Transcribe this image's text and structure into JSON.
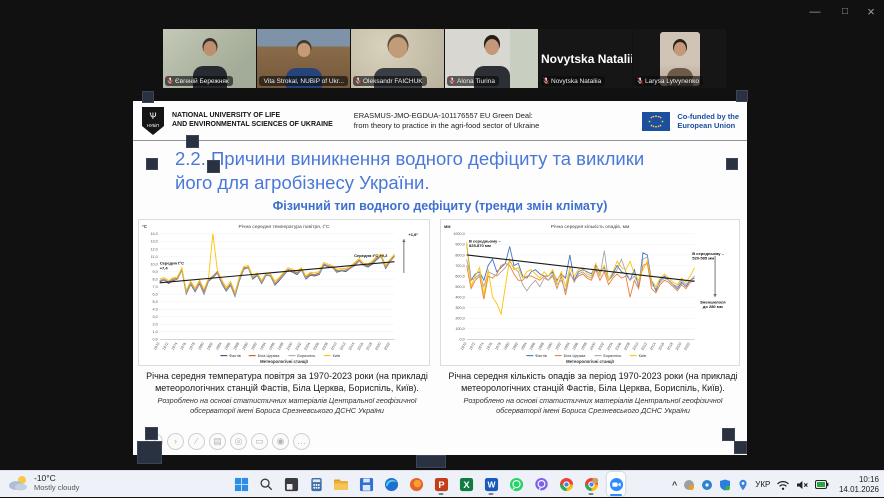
{
  "window": {
    "controls": {
      "minimize": "—",
      "maximize": "□",
      "close": "×"
    }
  },
  "participants": [
    {
      "label": "Євгеній Бережняк"
    },
    {
      "label": "Vita Strokal, NUBiP of Ukr...",
      "active_speaker": true
    },
    {
      "label": "Oleksandr FAICHUK"
    },
    {
      "label": "Alona Tiurina"
    },
    {
      "label": "Novytska Nataliia",
      "big_name": "Novytska Nataliia",
      "camera_off": true
    },
    {
      "label": "Larysa Lytvynenko"
    }
  ],
  "slide": {
    "logo_text": "НУБіП",
    "university_line1": "NATIONAL UNIVERSITY OF LIFE",
    "university_line2": "AND ENVIRONMENTAL SCIENCES OF UKRAINE",
    "erasmus_line1": "ERASMUS-JMO-EGDUA-101176557 EU Green Deal:",
    "erasmus_line2": "from theory to practice in the agri-food sector of Ukraine",
    "cofunded_line1": "Co-funded by the",
    "cofunded_line2": "European Union",
    "title_line1": "2.2. Причини виникнення водного дефіциту та виклики",
    "title_line2": "його для агробізнесу України.",
    "subtitle": "Фізичний тип водного дефіциту (тренди змін клімату)",
    "caption_left": "Річна середня температура повітря за 1970-2023 роки (на прикладі метеорологічних станцій Фастів, Біла Церква, Бориспіль, Київ).",
    "caption_right": "Річна середня кількість опадів за період 1970-2023 роки (на прикладі метеорологічних станцій Фастів, Біла Церква, Бориспіль, Київ).",
    "source_note": "Розроблено на основі статистичних матеріалів Центральної геофізичної обсерваторії імені Бориса Срезневського ДСНС України",
    "toolbar_glyphs": [
      "‹",
      "›",
      "∕",
      "▤",
      "◎",
      "▭",
      "◉",
      "…"
    ]
  },
  "chart_data": [
    {
      "type": "line",
      "title": "Річна середня температура повітря, t°C",
      "ylabel": "°C",
      "xlabel": "Метеорологічні станції",
      "ylim": [
        0,
        14
      ],
      "ystep": 1,
      "ydec": 1,
      "legend_position": "bottom",
      "x": [
        1970,
        1971,
        1972,
        1973,
        1974,
        1975,
        1976,
        1977,
        1978,
        1979,
        1980,
        1981,
        1982,
        1983,
        1984,
        1985,
        1986,
        1987,
        1988,
        1989,
        1990,
        1991,
        1992,
        1993,
        1994,
        1995,
        1996,
        1997,
        1998,
        1999,
        2000,
        2001,
        2002,
        2003,
        2004,
        2005,
        2006,
        2007,
        2008,
        2009,
        2010,
        2011,
        2012,
        2013,
        2014,
        2015,
        2016,
        2017,
        2018,
        2019,
        2020,
        2021,
        2022,
        2023
      ],
      "series": [
        {
          "name": "Фастів",
          "color": "#2e4b7e",
          "values": [
            7.6,
            7.9,
            7.4,
            7.8,
            8.0,
            9.2,
            6.0,
            7.3,
            6.3,
            7.4,
            6.0,
            7.7,
            8.2,
            8.8,
            7.4,
            6.4,
            7.2,
            5.7,
            7.8,
            9.3,
            9.5,
            8.0,
            8.5,
            7.4,
            8.5,
            8.4,
            7.2,
            7.8,
            8.5,
            9.2,
            8.9,
            8.6,
            9.2,
            8.0,
            8.5,
            8.4,
            8.6,
            9.8,
            9.7,
            9.5,
            8.9,
            9.1,
            9.0,
            9.4,
            9.8,
            10.4,
            9.8,
            9.6,
            10.0,
            10.6,
            11.0,
            9.4,
            10.3,
            11.0
          ]
        },
        {
          "name": "Біла Церква",
          "color": "#c55a11",
          "values": [
            7.8,
            8.0,
            7.6,
            8.0,
            8.1,
            9.3,
            6.2,
            7.5,
            6.5,
            7.6,
            6.3,
            7.9,
            8.4,
            9.0,
            7.6,
            6.6,
            7.4,
            5.9,
            8.0,
            9.5,
            9.6,
            8.2,
            8.6,
            7.6,
            8.6,
            8.5,
            7.4,
            8.0,
            8.7,
            9.3,
            9.1,
            8.8,
            9.3,
            8.2,
            8.7,
            8.6,
            8.8,
            10.0,
            9.8,
            9.6,
            9.1,
            9.2,
            9.2,
            9.5,
            10.0,
            10.5,
            9.9,
            9.8,
            10.2,
            10.8,
            11.1,
            9.6,
            10.4,
            11.1
          ]
        },
        {
          "name": "Бориспіль",
          "color": "#a6a6a6",
          "values": [
            7.7,
            8.0,
            7.5,
            7.9,
            8.0,
            9.2,
            6.1,
            7.4,
            6.4,
            7.5,
            6.1,
            7.8,
            8.3,
            8.9,
            7.5,
            6.5,
            7.3,
            5.8,
            7.9,
            9.4,
            9.5,
            8.1,
            8.6,
            7.5,
            8.6,
            8.4,
            7.3,
            7.9,
            8.6,
            9.3,
            9.0,
            8.7,
            9.2,
            8.1,
            8.6,
            8.5,
            8.7,
            9.9,
            9.8,
            9.5,
            9.0,
            9.2,
            9.1,
            9.4,
            9.9,
            10.4,
            9.8,
            9.7,
            10.1,
            10.7,
            11.0,
            9.5,
            10.3,
            11.0
          ]
        },
        {
          "name": "Київ",
          "color": "#ffc000",
          "values": [
            8.0,
            8.2,
            7.8,
            8.2,
            8.3,
            9.5,
            6.5,
            7.7,
            6.8,
            7.9,
            6.6,
            8.1,
            14.0,
            9.2,
            7.9,
            6.9,
            7.7,
            6.2,
            8.3,
            9.7,
            9.8,
            8.4,
            8.8,
            7.8,
            8.8,
            8.7,
            7.7,
            8.2,
            8.9,
            9.5,
            9.3,
            9.0,
            9.5,
            8.4,
            8.9,
            8.8,
            9.0,
            10.2,
            10.0,
            9.8,
            9.3,
            9.4,
            9.4,
            9.7,
            10.2,
            10.7,
            10.1,
            10.0,
            10.4,
            11.0,
            11.3,
            9.8,
            10.6,
            11.3
          ]
        }
      ],
      "trend": [
        7.5,
        10.3
      ],
      "annotations": [
        {
          "text": "Середня t°C\n+7,4",
          "xf": 0.0,
          "y": 9.9
        },
        {
          "text": "Середня t°C +9,2",
          "xf": 0.97,
          "y": 10.9,
          "anchor": "end"
        },
        {
          "text": "+1,8°",
          "xf": 1.08,
          "y": 13.7,
          "anchor": "middle"
        }
      ],
      "arrows": [
        {
          "xf": 1.04,
          "from": 8.8,
          "to": 13.3
        }
      ]
    },
    {
      "type": "line",
      "title": "Річна середня кількість опадів, мм",
      "ylabel": "мм",
      "xlabel": "Метеорологічні станції",
      "ylim": [
        0,
        1000
      ],
      "ystep": 100,
      "ydec": 1,
      "legend_position": "bottom",
      "x": [
        1970,
        1971,
        1972,
        1973,
        1974,
        1975,
        1976,
        1977,
        1978,
        1979,
        1980,
        1981,
        1982,
        1983,
        1984,
        1985,
        1986,
        1987,
        1988,
        1989,
        1990,
        1991,
        1992,
        1993,
        1994,
        1995,
        1996,
        1997,
        1998,
        1999,
        2000,
        2001,
        2002,
        2003,
        2004,
        2005,
        2006,
        2007,
        2008,
        2009,
        2010,
        2011,
        2012,
        2013,
        2014,
        2015,
        2016,
        2017,
        2018,
        2019,
        2020,
        2021,
        2022,
        2023
      ],
      "series": [
        {
          "name": "Фастів",
          "color": "#4472c4",
          "values": [
            900,
            560,
            620,
            640,
            560,
            700,
            760,
            640,
            680,
            720,
            880,
            700,
            720,
            600,
            580,
            640,
            660,
            620,
            600,
            600,
            640,
            560,
            620,
            580,
            800,
            560,
            640,
            660,
            640,
            620,
            700,
            640,
            680,
            560,
            620,
            700,
            640,
            620,
            560,
            660,
            500,
            820,
            800,
            560,
            460,
            560,
            600,
            560,
            520,
            480,
            540,
            500,
            560,
            580
          ]
        },
        {
          "name": "Біла Церква",
          "color": "#ed7d31",
          "values": [
            700,
            480,
            560,
            600,
            380,
            600,
            580,
            620,
            700,
            720,
            700,
            620,
            560,
            560,
            600,
            600,
            580,
            560,
            600,
            560,
            600,
            480,
            600,
            420,
            620,
            560,
            600,
            620,
            580,
            560,
            660,
            560,
            640,
            520,
            580,
            620,
            580,
            600,
            400,
            560,
            480,
            700,
            720,
            480,
            440,
            520,
            560,
            540,
            500,
            460,
            520,
            480,
            540,
            560
          ]
        },
        {
          "name": "Бориспіль",
          "color": "#a6a6a6",
          "values": [
            760,
            560,
            580,
            620,
            500,
            640,
            620,
            600,
            640,
            680,
            740,
            680,
            640,
            520,
            460,
            520,
            560,
            500,
            580,
            560,
            620,
            520,
            560,
            460,
            640,
            540,
            620,
            640,
            600,
            580,
            680,
            600,
            840,
            560,
            600,
            660,
            760,
            640,
            560,
            600,
            520,
            760,
            780,
            520,
            480,
            540,
            580,
            560,
            520,
            500,
            560,
            520,
            560,
            600
          ]
        },
        {
          "name": "Київ",
          "color": "#ffc000",
          "values": [
            920,
            500,
            600,
            680,
            420,
            660,
            400,
            340,
            240,
            500,
            760,
            660,
            680,
            580,
            640,
            660,
            620,
            580,
            640,
            600,
            660,
            540,
            640,
            500,
            680,
            600,
            660,
            680,
            620,
            600,
            720,
            620,
            700,
            560,
            640,
            740,
            680,
            660,
            740,
            620,
            560,
            660,
            740,
            560,
            500,
            580,
            620,
            580,
            540,
            520,
            580,
            540,
            600,
            680
          ]
        }
      ],
      "trend": [
        800,
        550
      ],
      "annotations": [
        {
          "text": "В середньому –\n825-870 мм",
          "xf": 0.01,
          "y": 920
        },
        {
          "text": "В середньому –\n520-585 мм",
          "xf": 0.99,
          "y": 800
        },
        {
          "text": "Зменшилося\nдо 280 мм",
          "xf": 1.08,
          "y": 340,
          "anchor": "middle"
        }
      ],
      "arrows": [
        {
          "xf": 1.09,
          "from": 790,
          "to": 400
        }
      ]
    }
  ],
  "taskbar": {
    "weather": {
      "temp": "-10°C",
      "condition": "Mostly cloudy"
    },
    "app_letters": {
      "powerpoint": "P",
      "excel": "X",
      "word": "W"
    },
    "tray": {
      "language": "УКР",
      "time": "10:16",
      "date": "14.01.2026"
    }
  }
}
